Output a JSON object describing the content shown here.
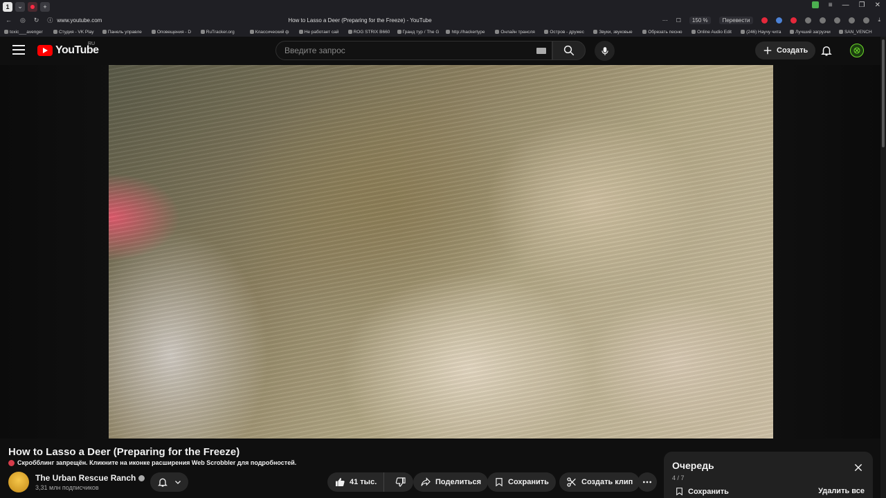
{
  "browser": {
    "active_tab_number": "1",
    "url": "www.youtube.com",
    "tab_title": "How to Lasso a Deer (Preparing for the Freeze) - YouTube",
    "zoom": "150 %",
    "translate": "Перевести",
    "bookmarks": [
      "toxic___avenger",
      "Студия - VK Play",
      "Панель управле",
      "Оповещения - D",
      "RuTracker.org",
      "Классический ф",
      "Не работает сай",
      "ROG STRIX B660",
      "Гранд тур / The G",
      "http://hackertype",
      "Онлайн трансля",
      "Остров - дружес",
      "Звуки, звуковые",
      "Обрезать песню",
      "Online Audio Edit",
      "(246) Научу чита",
      "Лучший загрузчи",
      "SAN_VENCH"
    ]
  },
  "header": {
    "logo_text": "YouTube",
    "region": "RU",
    "search_placeholder": "Введите запрос",
    "create_label": "Создать"
  },
  "video": {
    "title": "How to Lasso a Deer (Preparing for the Freeze)",
    "scrobbler_notice": "Скробблинг запрещён. Кликните на иконке расширения Web Scrobbler для подробностей."
  },
  "channel": {
    "name": "The Urban Rescue Ranch",
    "subscribers": "3,31 млн подписчиков"
  },
  "actions": {
    "likes": "41 тыс.",
    "share": "Поделиться",
    "save": "Сохранить",
    "clip": "Создать клип"
  },
  "queue": {
    "title": "Очередь",
    "count": "4 / 7",
    "save": "Сохранить",
    "clear": "Удалить все"
  },
  "colors": {
    "accent": "#ff0000",
    "background": "#0f0f0f",
    "chip": "#272727"
  }
}
